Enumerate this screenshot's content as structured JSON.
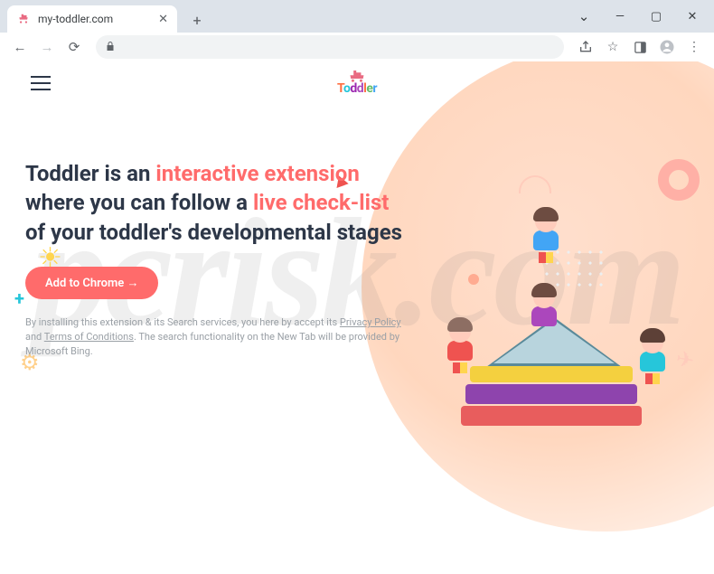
{
  "browser": {
    "tab_title": "my-toddler.com",
    "url_display": ""
  },
  "logo": {
    "brand": "Toddler"
  },
  "hero": {
    "h_part1": "Toddler is an ",
    "h_accent1": "interactive extension",
    "h_part2": " where you can follow a ",
    "h_accent2": "live check-list",
    "h_part3": " of your toddler's developmental stages"
  },
  "cta": {
    "label": "Add to Chrome →"
  },
  "disclaimer": {
    "line1_a": "By installing this extension & its Search services, you here by accept its ",
    "pp": "Privacy Policy",
    "line1_b": " and ",
    "tc": "Terms of Conditions",
    "line2": ". The search functionality on the New Tab will be provided by Microsoft Bing."
  }
}
